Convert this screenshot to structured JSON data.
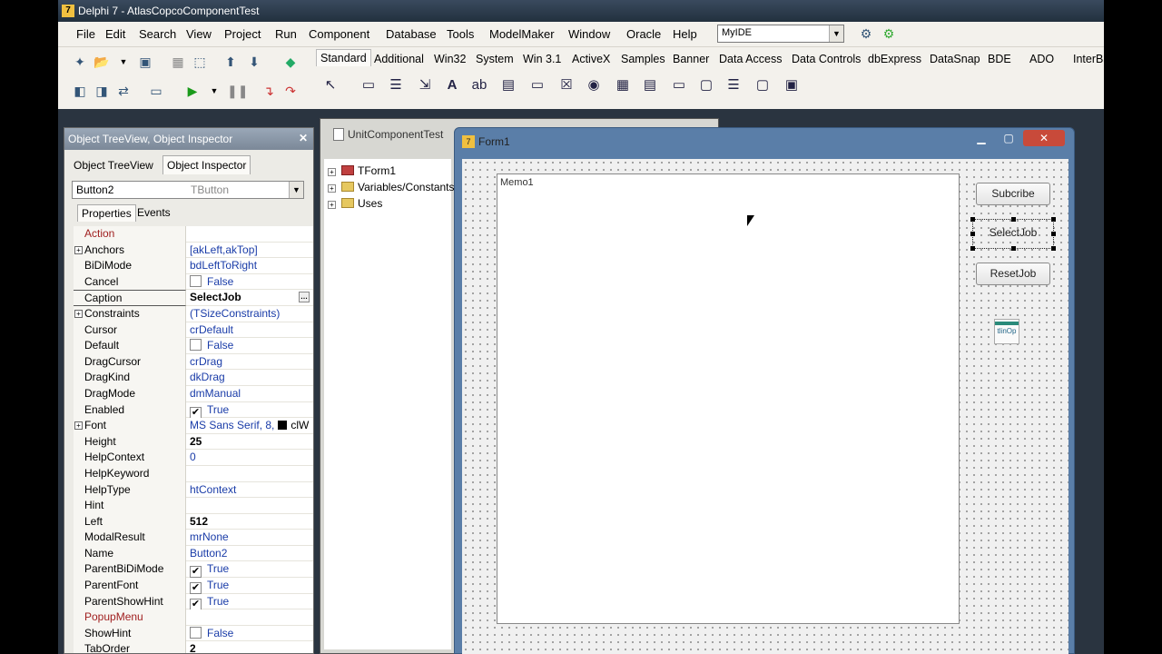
{
  "app": {
    "title": "Delphi 7 - AtlasCopcoComponentTest"
  },
  "menu": [
    "File",
    "Edit",
    "Search",
    "View",
    "Project",
    "Run",
    "Component",
    "Database",
    "Tools",
    "ModelMaker",
    "Window",
    "Oracle",
    "Help"
  ],
  "desktop_combo": "MyIDE",
  "palette_tabs": [
    "Standard",
    "Additional",
    "Win32",
    "System",
    "Win 3.1",
    "ActiveX",
    "Samples",
    "Banner",
    "Data Access",
    "Data Controls",
    "dbExpress",
    "DataSnap",
    "BDE",
    "ADO",
    "InterBase"
  ],
  "inspector": {
    "title": "Object TreeView, Object Inspector",
    "tabs": [
      "Object TreeView",
      "Object Inspector"
    ],
    "selected_object": "Button2",
    "selected_type": "TButton",
    "subtabs": [
      "Properties",
      "Events"
    ],
    "properties": [
      {
        "name": "Action",
        "value": "",
        "style": "red"
      },
      {
        "name": "Anchors",
        "value": "[akLeft,akTop]",
        "expand": true
      },
      {
        "name": "BiDiMode",
        "value": "bdLeftToRight"
      },
      {
        "name": "Cancel",
        "value": "False",
        "check": "off"
      },
      {
        "name": "Caption",
        "value": "SelectJob",
        "bold": true,
        "sel": true
      },
      {
        "name": "Constraints",
        "value": "(TSizeConstraints)",
        "expand": true
      },
      {
        "name": "Cursor",
        "value": "crDefault"
      },
      {
        "name": "Default",
        "value": "False",
        "check": "off"
      },
      {
        "name": "DragCursor",
        "value": "crDrag"
      },
      {
        "name": "DragKind",
        "value": "dkDrag"
      },
      {
        "name": "DragMode",
        "value": "dmManual"
      },
      {
        "name": "Enabled",
        "value": "True",
        "check": "on"
      },
      {
        "name": "Font",
        "value": "MS Sans Serif, 8,",
        "expand": true,
        "swatch": true
      },
      {
        "name": "Height",
        "value": "25",
        "bold": true
      },
      {
        "name": "HelpContext",
        "value": "0"
      },
      {
        "name": "HelpKeyword",
        "value": ""
      },
      {
        "name": "HelpType",
        "value": "htContext"
      },
      {
        "name": "Hint",
        "value": ""
      },
      {
        "name": "Left",
        "value": "512",
        "bold": true
      },
      {
        "name": "ModalResult",
        "value": "mrNone"
      },
      {
        "name": "Name",
        "value": "Button2"
      },
      {
        "name": "ParentBiDiMode",
        "value": "True",
        "check": "on"
      },
      {
        "name": "ParentFont",
        "value": "True",
        "check": "on"
      },
      {
        "name": "ParentShowHint",
        "value": "True",
        "check": "on"
      },
      {
        "name": "PopupMenu",
        "value": "",
        "style": "red"
      },
      {
        "name": "ShowHint",
        "value": "False",
        "check": "off"
      },
      {
        "name": "TabOrder",
        "value": "2",
        "bold": true
      }
    ]
  },
  "unit": {
    "tab": "UnitComponentTest",
    "tree": [
      "TForm1",
      "Variables/Constants",
      "Uses"
    ]
  },
  "form": {
    "title": "Form1",
    "memo": "Memo1",
    "buttons": [
      "Subcribe",
      "SelectJob",
      "ResetJob"
    ],
    "component": "tlinOp",
    "font_color": "clW"
  }
}
